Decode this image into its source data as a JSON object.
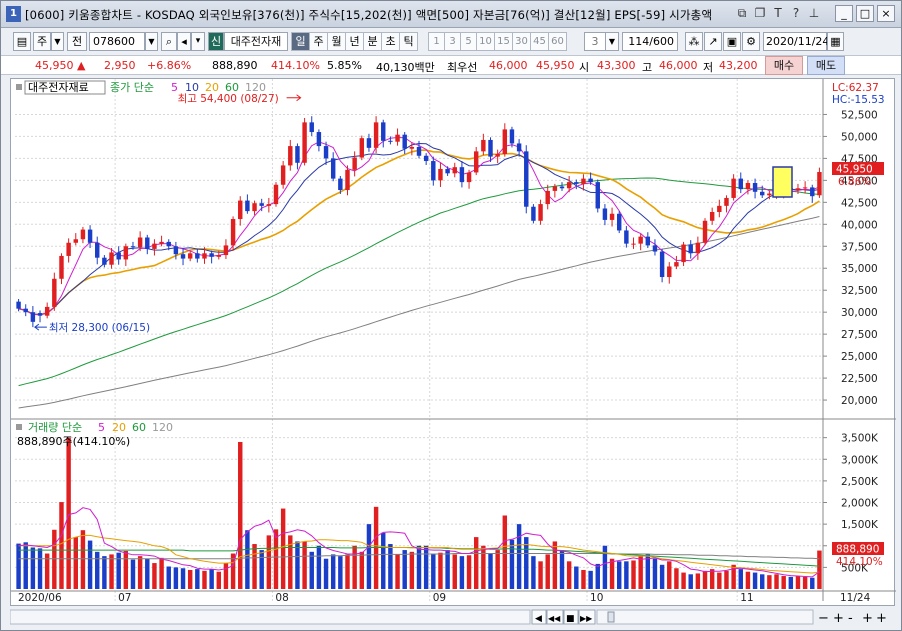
{
  "titlebar": {
    "number": "1",
    "title": "[0600] 키움종합차트 - KOSDAQ 외국인보유[376(천)] 주식수[15,202(천)] 액면[500] 자본금[76(억)] 결산[12월] EPS[-59] 시가총액",
    "icons": [
      "restore-icon",
      "copy-icon",
      "text-icon",
      "help-icon",
      "pin-icon"
    ],
    "window_buttons": [
      "_",
      "□",
      "×"
    ]
  },
  "toolbar": {
    "ju": "주",
    "jeon": "전",
    "code": "078600",
    "badge": "신",
    "stock_name": "대주전자재",
    "periods": [
      "일",
      "주",
      "월",
      "년",
      "분",
      "초",
      "틱"
    ],
    "minute_options": [
      "1",
      "3",
      "5",
      "10",
      "15",
      "30",
      "45",
      "60"
    ],
    "interval": "3",
    "count": "114/600",
    "date": "2020/11/24"
  },
  "infobar": {
    "price": "45,950",
    "arrow": "▲",
    "change": "2,950",
    "rate": "+6.86%",
    "volume": "888,890",
    "vol_ratio": "414.10%",
    "turnover": "5.85%",
    "amount": "40,130백만",
    "best_label": "최우선",
    "best_ask": "46,000",
    "best_bid": "45,950",
    "open_label": "시",
    "open": "43,300",
    "high_label": "고",
    "high": "46,000",
    "low_label": "저",
    "low": "43,200",
    "buy": "매수",
    "sell": "매도"
  },
  "colors": {
    "up": "#e02020",
    "down": "#1a3ec8",
    "ma5": "#d020d0",
    "ma10": "#2a3aa8",
    "ma20": "#e8a000",
    "ma60": "#1e9a3c",
    "ma120": "#808080",
    "grid": "#d8d8d8"
  },
  "price_legend": {
    "stock": "대주전자재료",
    "label": "종가 단순",
    "periods": [
      "5",
      "10",
      "20",
      "60",
      "120"
    ],
    "high_annot": "최고 54,400 (08/27)",
    "low_annot": "최저 28,300 (06/15)",
    "lc": "LC:62.37",
    "hc": "HC:-15.53",
    "last_price": "45,950",
    "last_rate": "6.86%"
  },
  "volume_legend": {
    "label": "거래량 단순",
    "periods": [
      "5",
      "20",
      "60",
      "120"
    ],
    "current": "888,890주(414.10%)",
    "last_vol": "888,890",
    "last_ratio": "414.10%"
  },
  "chart_data": {
    "type": "candlestick",
    "price_axis": [
      "52,500",
      "50,000",
      "47,500",
      "45,000",
      "42,500",
      "40,000",
      "37,500",
      "35,000",
      "32,500",
      "30,000",
      "27,500",
      "25,000",
      "22,500",
      "20,000"
    ],
    "price_ticks": [
      52500,
      50000,
      47500,
      45000,
      42500,
      40000,
      37500,
      35000,
      32500,
      30000,
      27500,
      25000,
      22500,
      20000
    ],
    "volume_axis": [
      "3,500K",
      "3,000K",
      "2,500K",
      "2,000K",
      "1,500K",
      "1,000K",
      "500K"
    ],
    "volume_ticks": [
      3500,
      3000,
      2500,
      2000,
      1500,
      1000,
      500
    ],
    "x_labels": [
      "2020/06",
      "07",
      "08",
      "09",
      "10",
      "11",
      "11/24"
    ],
    "x_label_index": [
      0,
      14,
      36,
      58,
      80,
      101,
      113
    ],
    "close": [
      30400,
      30000,
      28900,
      29600,
      30600,
      33800,
      36400,
      37900,
      38300,
      39400,
      37900,
      36200,
      35400,
      36800,
      36000,
      37500,
      37400,
      38500,
      37200,
      37800,
      38000,
      37500,
      36600,
      36100,
      36700,
      36100,
      36700,
      36300,
      36500,
      37600,
      40600,
      42700,
      41500,
      42400,
      42100,
      42300,
      44500,
      46700,
      48900,
      47000,
      51600,
      50500,
      48900,
      47500,
      45200,
      43900,
      46200,
      47600,
      49800,
      48700,
      51600,
      49500,
      49400,
      50200,
      48600,
      48800,
      47800,
      47200,
      45000,
      46300,
      45800,
      46500,
      44800,
      45900,
      48300,
      49600,
      47700,
      48000,
      50800,
      49200,
      48300,
      42000,
      40400,
      42300,
      43800,
      44300,
      44100,
      44800,
      44600,
      45200,
      44800,
      41800,
      40500,
      41200,
      39300,
      37800,
      37800,
      38600,
      37600,
      36900,
      34000,
      35200,
      35700,
      37700,
      36700,
      37900,
      40400,
      41400,
      42100,
      43000,
      45200,
      44000,
      44700,
      43700,
      43300,
      43500,
      43700,
      44100,
      43900,
      44100,
      44200,
      43200,
      45950
    ],
    "open": [
      31200,
      30400,
      30000,
      29900,
      29600,
      30600,
      33800,
      36400,
      37900,
      38300,
      39400,
      37900,
      36200,
      35400,
      36800,
      36000,
      37500,
      37400,
      38500,
      37200,
      37800,
      38000,
      37500,
      36600,
      36100,
      36700,
      36100,
      36700,
      36300,
      36500,
      37600,
      40600,
      42700,
      41500,
      42400,
      42100,
      42300,
      44500,
      46700,
      48900,
      47000,
      51600,
      50500,
      48900,
      47500,
      45200,
      43900,
      46200,
      47600,
      49800,
      48700,
      51600,
      49500,
      49400,
      50200,
      48600,
      48800,
      47800,
      47200,
      45000,
      46300,
      45800,
      46500,
      44800,
      45900,
      48300,
      49600,
      47700,
      48000,
      50800,
      49200,
      48300,
      42000,
      40400,
      42300,
      43800,
      44300,
      44100,
      44800,
      44600,
      45200,
      44800,
      41800,
      40500,
      41200,
      39300,
      37800,
      37800,
      38600,
      37600,
      36900,
      34000,
      35200,
      35700,
      37700,
      36700,
      37900,
      40400,
      41400,
      42100,
      43000,
      45200,
      44000,
      44700,
      43700,
      43300,
      43500,
      43700,
      44100,
      43900,
      44100,
      44200,
      43300
    ],
    "volume": [
      1050,
      1080,
      960,
      940,
      820,
      1370,
      2010,
      3500,
      1200,
      1360,
      1120,
      860,
      760,
      800,
      840,
      880,
      680,
      760,
      700,
      600,
      720,
      520,
      500,
      480,
      440,
      460,
      420,
      460,
      400,
      600,
      820,
      3400,
      1360,
      1040,
      900,
      1240,
      1380,
      1860,
      1240,
      1100,
      1100,
      860,
      1000,
      700,
      800,
      760,
      800,
      1000,
      860,
      1500,
      1900,
      1300,
      1040,
      800,
      900,
      860,
      1000,
      1000,
      800,
      840,
      900,
      800,
      760,
      780,
      1200,
      1000,
      820,
      900,
      1700,
      1140,
      1500,
      1200,
      760,
      640,
      800,
      1100,
      900,
      640,
      520,
      440,
      420,
      580,
      1000,
      700,
      640,
      640,
      660,
      760,
      800,
      700,
      560,
      640,
      480,
      380,
      340,
      360,
      420,
      460,
      380,
      420,
      560,
      460,
      400,
      380,
      340,
      320,
      340,
      300,
      280,
      300,
      280,
      260,
      889
    ],
    "ma5_vol": [
      1000,
      1020,
      1000,
      980,
      960,
      1030,
      1240,
      1720,
      1760,
      1880,
      1840,
      1610,
      1060,
      980,
      880,
      830,
      790,
      790,
      780,
      760,
      690,
      660,
      610,
      560,
      540,
      480,
      460,
      460,
      440,
      470,
      540,
      1140,
      1320,
      1450,
      1500,
      1590,
      1190,
      1290,
      1320,
      1370,
      1340,
      1230,
      1070,
      950,
      890,
      850,
      810,
      810,
      830,
      980,
      1210,
      1310,
      1320,
      1310,
      1290,
      1000,
      920,
      910,
      900,
      900,
      880,
      870,
      820,
      820,
      880,
      910,
      930,
      940,
      1120,
      1150,
      1210,
      1290,
      1260,
      1240,
      1040,
      900,
      880,
      850,
      780,
      720,
      580,
      520,
      590,
      630,
      660,
      690,
      720,
      690,
      700,
      720,
      670,
      670,
      640,
      560,
      460,
      440,
      400,
      410,
      410,
      430,
      470,
      480,
      460,
      440,
      420,
      390,
      360,
      330,
      310,
      300,
      290,
      280,
      400
    ],
    "ma20_vol": [
      1000,
      1000,
      1000,
      1000,
      1000,
      1000,
      1050,
      1150,
      1200,
      1240,
      1240,
      1210,
      1180,
      1160,
      1140,
      1120,
      1100,
      1080,
      1040,
      1000,
      980,
      920,
      790,
      750,
      700,
      670,
      640,
      620,
      600,
      600,
      610,
      750,
      780,
      810,
      840,
      880,
      920,
      980,
      1030,
      1070,
      1100,
      1110,
      1140,
      1140,
      1130,
      1120,
      1120,
      1100,
      1080,
      1000,
      1000,
      980,
      960,
      960,
      960,
      950,
      950,
      960,
      960,
      960,
      960,
      930,
      920,
      920,
      920,
      930,
      940,
      950,
      990,
      1000,
      1020,
      1030,
      1010,
      990,
      980,
      980,
      980,
      960,
      930,
      900,
      880,
      860,
      840,
      820,
      800,
      770,
      760,
      760,
      760,
      730,
      700,
      680,
      660,
      640,
      620,
      600,
      580,
      560,
      540,
      520,
      500,
      490,
      480,
      470,
      450,
      430,
      420,
      410,
      400,
      390,
      380,
      370,
      390
    ],
    "ma60_vol": [
      900,
      900,
      900,
      900,
      900,
      900,
      900,
      900,
      900,
      900,
      900,
      900,
      900,
      900,
      900,
      900,
      900,
      900,
      900,
      900,
      900,
      900,
      900,
      900,
      880,
      880,
      880,
      880,
      880,
      880,
      880,
      900,
      920,
      930,
      940,
      940,
      950,
      960,
      960,
      960,
      960,
      960,
      960,
      960,
      960,
      950,
      950,
      950,
      950,
      960,
      960,
      960,
      960,
      960,
      960,
      960,
      960,
      960,
      950,
      950,
      940,
      940,
      930,
      930,
      930,
      930,
      920,
      920,
      930,
      930,
      920,
      920,
      920,
      910,
      900,
      900,
      890,
      880,
      870,
      860,
      850,
      840,
      830,
      820,
      810,
      800,
      790,
      780,
      770,
      760,
      750,
      740,
      730,
      720,
      710,
      700,
      690,
      680,
      670,
      660,
      650,
      640,
      630,
      620,
      610,
      600,
      590,
      580,
      570,
      560,
      550,
      540,
      530
    ],
    "ma120_vol": [
      700,
      700,
      700,
      700,
      700,
      700,
      700,
      700,
      700,
      700,
      700,
      700,
      700,
      700,
      700,
      700,
      700,
      700,
      700,
      700,
      700,
      700,
      700,
      700,
      700,
      700,
      700,
      700,
      700,
      700,
      700,
      710,
      720,
      720,
      730,
      730,
      740,
      740,
      750,
      750,
      760,
      760,
      760,
      770,
      770,
      770,
      780,
      780,
      780,
      790,
      790,
      800,
      800,
      800,
      800,
      810,
      810,
      810,
      810,
      810,
      810,
      820,
      820,
      820,
      820,
      820,
      820,
      820,
      820,
      820,
      820,
      820,
      820,
      820,
      820,
      820,
      820,
      820,
      820,
      820,
      820,
      820,
      820,
      810,
      810,
      810,
      810,
      810,
      810,
      800,
      800,
      800,
      790,
      790,
      790,
      780,
      780,
      780,
      770,
      770,
      760,
      760,
      750,
      750,
      740,
      740,
      730,
      730,
      720,
      720,
      710,
      710,
      700
    ],
    "high_point": {
      "index": 40,
      "value": 54400
    },
    "low_point": {
      "index": 2,
      "value": 28300
    }
  },
  "bottombar": {
    "controls": [
      "◀",
      "◀◀",
      "■",
      "▶▶"
    ],
    "zoom": [
      "−",
      "+"
    ],
    "extra": [
      "-",
      "+"
    ]
  }
}
